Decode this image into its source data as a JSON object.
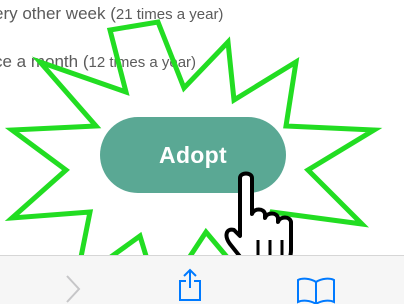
{
  "options": [
    {
      "main": "ery other week (",
      "detail": "21 times a year)"
    },
    {
      "main": "ce a month (",
      "detail": "12 times a year)"
    }
  ],
  "adopt_button": {
    "label": "Adopt",
    "color": "#5aa894"
  },
  "burst_color": "#22dd22",
  "toolbar": {
    "icons": [
      "forward-chevron-icon",
      "share-icon",
      "bookmarks-icon"
    ],
    "icon_color": "#007aff"
  }
}
